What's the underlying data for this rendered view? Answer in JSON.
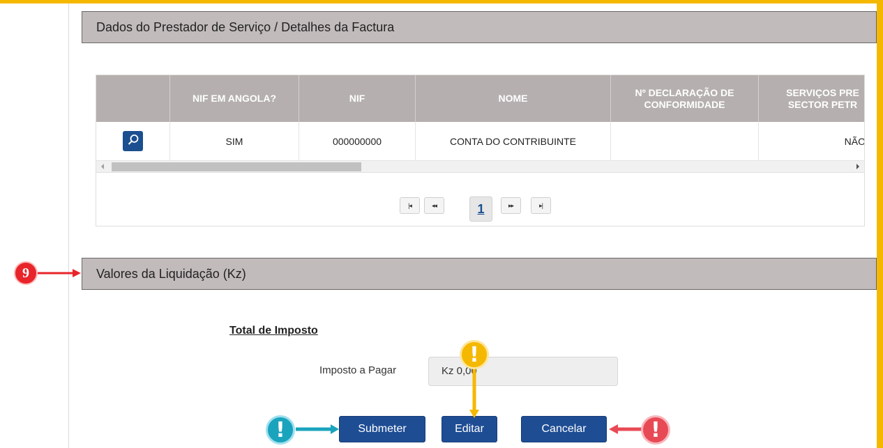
{
  "section1": {
    "title": "Dados do Prestador de Serviço / Detalhes da Factura"
  },
  "table": {
    "headers": [
      "NIF EM ANGOLA?",
      "NIF",
      "NOME",
      "Nº DECLARAÇÃO DE CONFORMIDADE",
      "SERVIÇOS PRE SECTOR PETR"
    ],
    "row": {
      "nif_em_angola": "SIM",
      "nif": "000000000",
      "nome": "CONTA DO CONTRIBUINTE",
      "declaracao": "",
      "servicos": "NÃO"
    },
    "icons": {
      "search": "search-icon"
    }
  },
  "pagination": {
    "first": "first-page-icon",
    "prev": "previous-page-icon",
    "current": "1",
    "next": "next-page-icon",
    "last": "last-page-icon"
  },
  "section2": {
    "title": "Valores da Liquidação (Kz)"
  },
  "totals": {
    "subtitle": "Total de Imposto",
    "imposto_label": "Imposto a Pagar",
    "imposto_value": "Kz 0,00"
  },
  "buttons": {
    "submeter": "Submeter",
    "editar": "Editar",
    "cancelar": "Cancelar"
  },
  "annotations": {
    "step_number": "9",
    "alert_symbol": "!"
  },
  "colors": {
    "accent": "#f5b800",
    "primary_button": "#1e4d94",
    "header_bg": "#c2bbbb",
    "alert_teal": "#1aa3bd",
    "alert_yellow": "#f5b800",
    "alert_red": "#e84a55",
    "step_red": "#e8252a"
  }
}
